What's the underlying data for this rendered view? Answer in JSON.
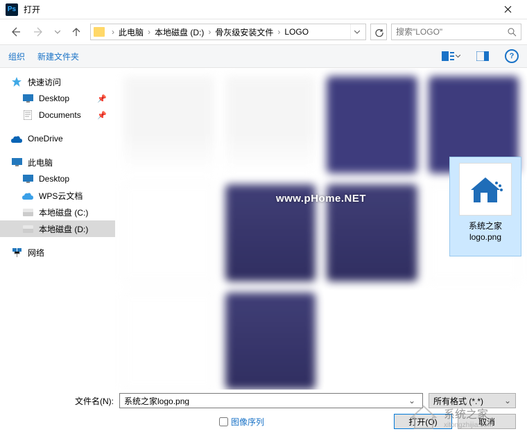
{
  "title": "打开",
  "breadcrumb": {
    "p0": "此电脑",
    "p1": "本地磁盘 (D:)",
    "p2": "骨灰级安装文件",
    "p3": "LOGO"
  },
  "search": {
    "placeholder": "搜索\"LOGO\""
  },
  "toolbar": {
    "organize": "组织",
    "newfolder": "新建文件夹"
  },
  "sidebar": {
    "quick": "快速访问",
    "desktop": "Desktop",
    "documents": "Documents",
    "onedrive": "OneDrive",
    "thispc": "此电脑",
    "desktop2": "Desktop",
    "wps": "WPS云文档",
    "diskc": "本地磁盘 (C:)",
    "diskd": "本地磁盘 (D:)",
    "network": "网络"
  },
  "selected_file": {
    "line1": "系统之家",
    "line2": "logo.png"
  },
  "watermark": "www.pHome.NET",
  "footer": {
    "filename_label": "文件名(N):",
    "filename_value": "系统之家logo.png",
    "format": "所有格式 (*.*)",
    "image_sequence": "图像序列",
    "open": "打开(O)",
    "cancel": "取消"
  },
  "corner": {
    "cn": "系统之家",
    "url": "xitongzhijia.com"
  }
}
